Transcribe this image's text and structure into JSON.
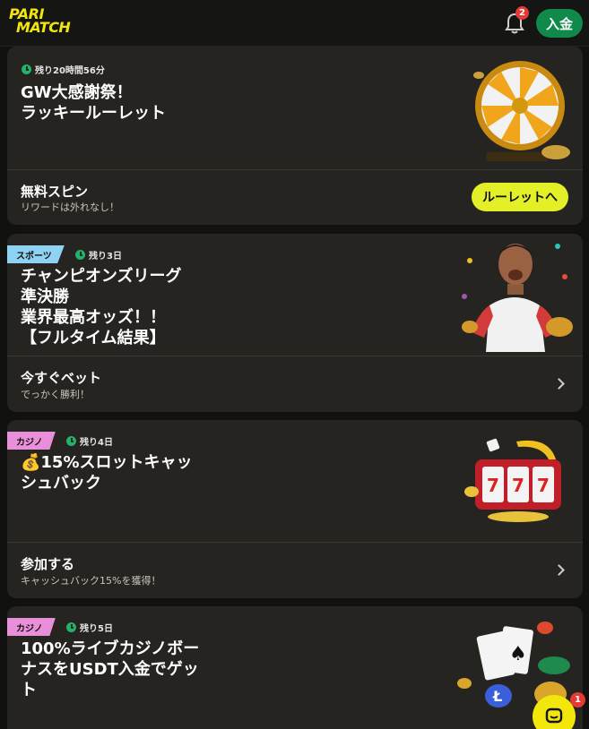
{
  "header": {
    "logo_line1": "PARI",
    "logo_line2": "MATCH",
    "notification_count": "2",
    "deposit_label": "入金"
  },
  "promos": [
    {
      "timer": "残り20時間56分",
      "title": "GW大感謝祭！\nラッキールーレット",
      "cta_title": "無料スピン",
      "cta_sub": "リワードは外れなし！",
      "button_label": "ルーレットへ",
      "art_icon": "roulette-wheel"
    },
    {
      "tag": "スポーツ",
      "tag_color": "#8fd3f4",
      "timer": "残り3日",
      "title": "チャンピオンズリーグ\n準決勝\n業界最高オッズ！！\n【フルタイム結果】",
      "cta_title": "今すぐベット",
      "cta_sub": "でっかく勝利！",
      "art_icon": "football-fan"
    },
    {
      "tag": "カジノ",
      "tag_color": "#e98ed8",
      "timer": "残り4日",
      "title": "💰15%スロットキャッ\nシュバック",
      "cta_title": "参加する",
      "cta_sub": "キャッシュバック15%を獲得！",
      "art_icon": "slot-machine"
    },
    {
      "tag": "カジノ",
      "tag_color": "#e98ed8",
      "timer": "残り5日",
      "title": "100%ライブカジノボー\nナスをUSDT入金でゲッ\nト",
      "art_icon": "cards-and-chips"
    }
  ],
  "chat": {
    "badge_count": "1",
    "icon": "chat-icon"
  },
  "colors": {
    "accent_yellow": "#e3ef27",
    "brand_green": "#0f8a4b",
    "timer_green": "#1fb36b",
    "card_bg": "#262420"
  }
}
